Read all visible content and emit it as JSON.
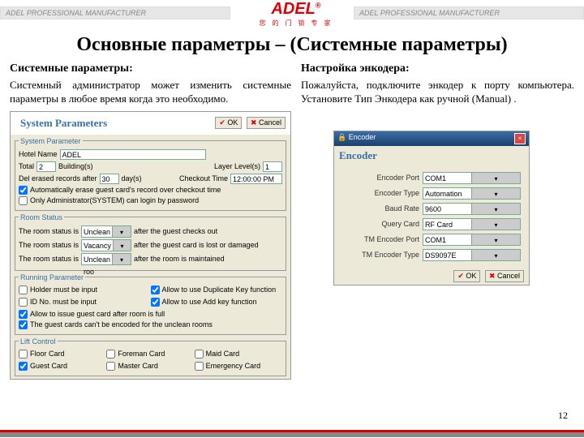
{
  "header": {
    "bar": "ADEL PROFESSIONAL MANUFACTURER",
    "logo_big": "ADEL",
    "logo_sub": "您 的 门 锁 专 家"
  },
  "title": "Основные параметры – (Системные параметры)",
  "left": {
    "head": "Системные параметры:",
    "body": "Системный администратор может изменить системные параметры в любое время когда это необходимо."
  },
  "right": {
    "head": "Настройка энкодера:",
    "body": "Пожалуйста, подключите энкодер к порту компьютера. Установите Тип Энкодера как ручной (Manual) ."
  },
  "page": "12",
  "btn_ok": "OK",
  "btn_cancel": "Cancel",
  "sp": {
    "title": "System Parameters",
    "g1": "System Parameter",
    "hotel_l": "Hotel Name",
    "hotel_v": "ADEL",
    "total_l": "Total",
    "total_v": "2",
    "build_l": "Building(s)",
    "layer_l": "Layer Level(s)",
    "layer_v": "1",
    "del_l": "Del erased records after",
    "del_v": "30",
    "days_l": "day(s)",
    "co_l": "Checkout Time",
    "co_v": "12:00:00 PM",
    "cb_erase": "Automatically erase guest card's record over checkout time",
    "cb_admin": "Only Administrator(SYSTEM) can login by password",
    "g2": "Room Status",
    "rs_pre": "The room status is",
    "rs1_v": "Unclean roo",
    "rs1_a": "after the guest checks out",
    "rs2_v": "Vacancy roo",
    "rs2_a": "after the guest card is lost or damaged",
    "rs3_v": "Unclean roo",
    "rs3_a": "after the room is maintained",
    "g3": "Running Parameter",
    "rp1": "Holder must be input",
    "rp2": "ID No. must be input",
    "rp3": "Allow to use Duplicate Key function",
    "rp4": "Allow to use Add key function",
    "rp5": "Allow to issue guest card after room is full",
    "rp6": "The guest cards can't be encoded for the unclean rooms",
    "g4": "Lift Control",
    "lc1": "Floor Card",
    "lc2": "Foreman Card",
    "lc3": "Maid Card",
    "lc4": "Guest Card",
    "lc5": "Master Card",
    "lc6": "Emergency Card"
  },
  "enc": {
    "win": "Encoder",
    "title": "Encoder",
    "port_l": "Encoder Port",
    "port_v": "COM1",
    "type_l": "Encoder Type",
    "type_v": "Automation",
    "baud_l": "Baud Rate",
    "baud_v": "9600",
    "query_l": "Query Card",
    "query_v": "RF Card",
    "tmp_l": "TM Encoder Port",
    "tmp_v": "COM1",
    "tmt_l": "TM Encoder Type",
    "tmt_v": "DS9097E"
  }
}
